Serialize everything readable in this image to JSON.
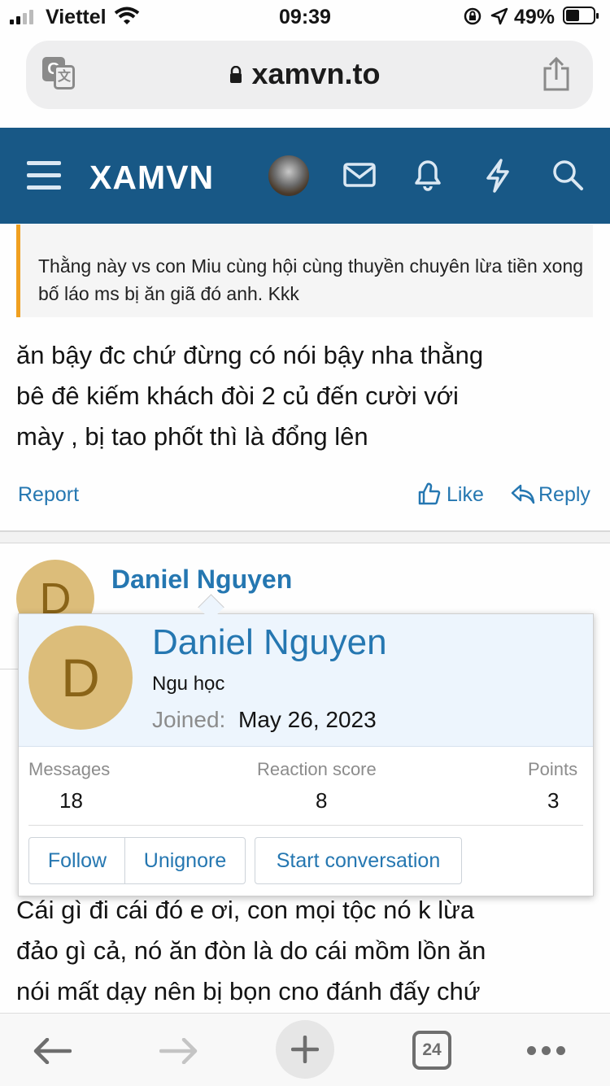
{
  "status_bar": {
    "carrier": "Viettel",
    "time": "09:39",
    "battery": "49%"
  },
  "browser": {
    "url": "xamvn.to",
    "tab_count": "24"
  },
  "site": {
    "logo": "XAMVN"
  },
  "post1": {
    "quote": "Thằng này vs con Miu cùng hội cùng thuyền chuyên lừa tiền xong bố láo ms bị ăn giã đó anh. Kkk",
    "body_lines": [
      "ăn bậy đc chứ đừng có nói bậy nha thằng",
      "bê đê kiếm khách đòi 2 củ đến cười với",
      "mày , bị tao phốt thì là đổng lên"
    ],
    "report": "Report",
    "like": "Like",
    "reply": "Reply"
  },
  "post2": {
    "author": "Daniel Nguyen",
    "avatar_letter": "D",
    "body_lines": [
      "Cái gì đi cái đó e ơi, con mọi tộc nó k lừa",
      "đảo gì cả, nó ăn đòn là do cái mồm lồn ăn",
      "nói mất dạy nên bị bọn cno đánh đấy chứ"
    ]
  },
  "member_card": {
    "name": "Daniel Nguyen",
    "title": "Ngu học",
    "joined_label": "Joined:",
    "joined_date": "May 26, 2023",
    "avatar_letter": "D",
    "stats": [
      {
        "label": "Messages",
        "value": "18"
      },
      {
        "label": "Reaction score",
        "value": "8"
      },
      {
        "label": "Points",
        "value": "3"
      }
    ],
    "buttons": {
      "follow": "Follow",
      "unignore": "Unignore",
      "start_conversation": "Start conversation"
    }
  },
  "icons": {
    "translate": "translate-icon",
    "lock": "lock-icon",
    "share": "share-icon",
    "menu": "hamburger-menu-icon",
    "mail": "envelope-icon",
    "bell": "bell-icon",
    "bolt": "lightning-icon",
    "search": "search-icon",
    "like": "thumbs-up-icon",
    "reply": "reply-arrow-icon",
    "back": "back-arrow-icon",
    "forward": "forward-arrow-icon",
    "new_tab": "plus-icon",
    "more": "more-dots-icon"
  },
  "colors": {
    "header_bg": "#185886",
    "link": "#2577b1",
    "quote_border": "#f0a020",
    "avatar_bg": "#dcbd7a"
  }
}
